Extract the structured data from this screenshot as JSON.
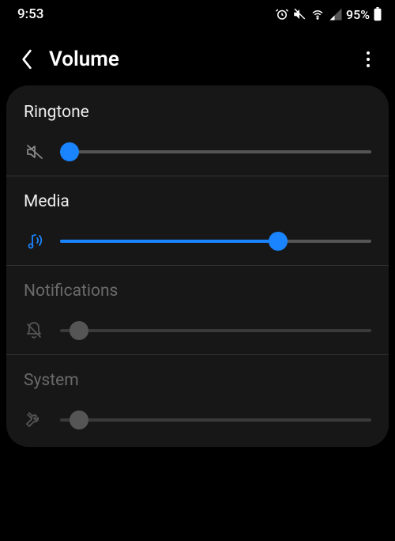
{
  "status": {
    "time": "9:53",
    "battery_text": "95%"
  },
  "header": {
    "title": "Volume"
  },
  "sliders": {
    "ringtone": {
      "label": "Ringtone",
      "percent": 3,
      "enabled": true,
      "fill": false
    },
    "media": {
      "label": "Media",
      "percent": 70,
      "enabled": true,
      "fill": true
    },
    "notifications": {
      "label": "Notifications",
      "percent": 6,
      "enabled": false,
      "fill": false
    },
    "system": {
      "label": "System",
      "percent": 6,
      "enabled": false,
      "fill": false
    }
  }
}
